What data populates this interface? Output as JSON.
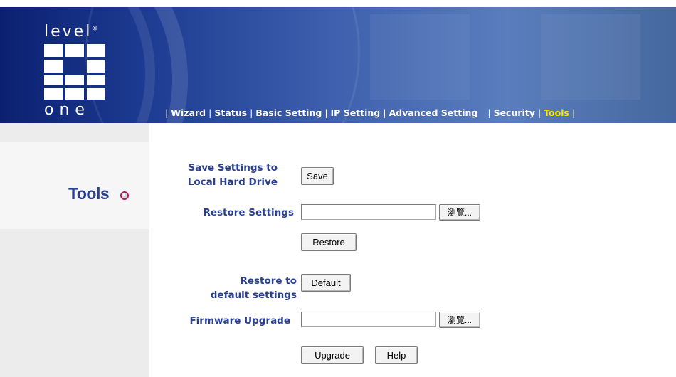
{
  "brand": {
    "logo_top": "level",
    "logo_bottom": "one"
  },
  "nav": {
    "items": [
      "Wizard",
      "Status",
      "Basic Setting",
      "IP Setting",
      "Advanced Setting",
      "Security",
      "Tools"
    ],
    "active": "Tools"
  },
  "page": {
    "title": "Tools"
  },
  "form": {
    "save": {
      "label_line1": "Save Settings to",
      "label_line2": "Local Hard Drive",
      "button": "Save"
    },
    "restore": {
      "label": "Restore Settings",
      "value": "",
      "browse_button": "瀏覽...",
      "button": "Restore"
    },
    "default": {
      "label_line1": "Restore to",
      "label_line2": "default settings",
      "button": "Default"
    },
    "firmware": {
      "label": "Firmware Upgrade",
      "value": "",
      "browse_button": "瀏覽...",
      "upgrade_button": "Upgrade",
      "help_button": "Help"
    }
  },
  "colors": {
    "accent": "#2a3f8f",
    "nav_active": "#ffe600",
    "header": "#1d3c92",
    "sidebar": "#ececec"
  }
}
